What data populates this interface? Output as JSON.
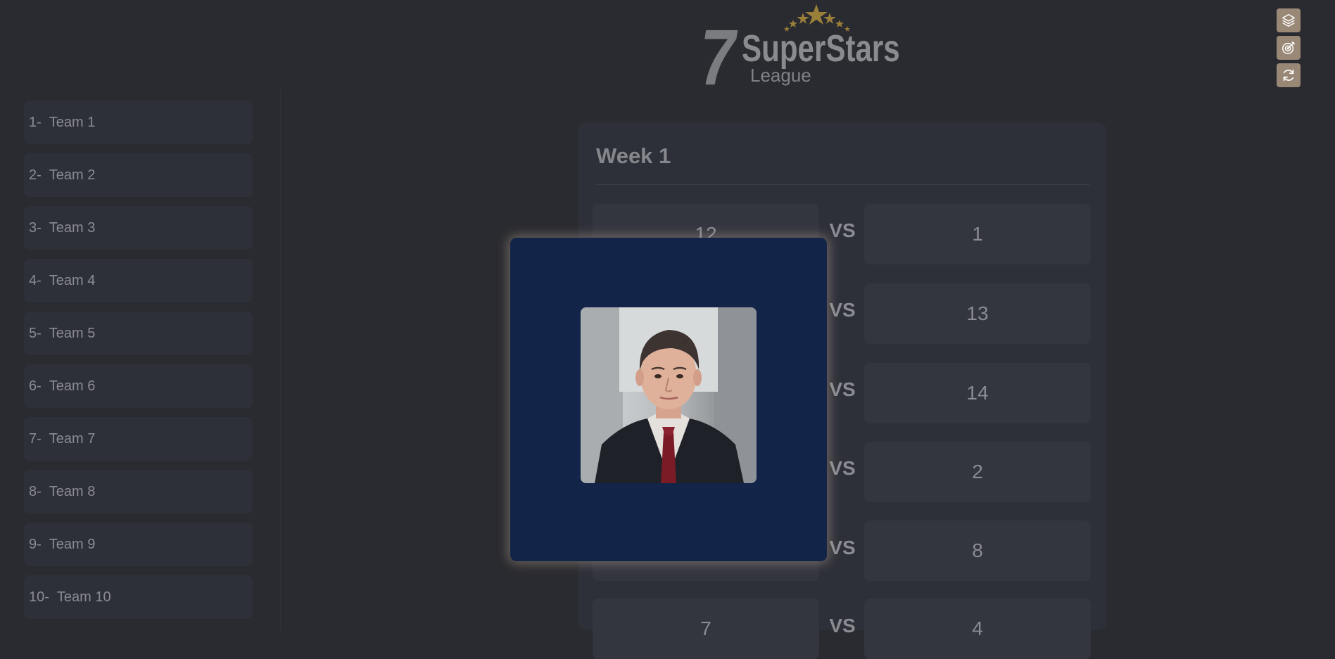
{
  "brand": {
    "number": "7",
    "name": "SuperStars",
    "subtitle": "League",
    "star_color": "#9a7f3a"
  },
  "toolbar": {
    "buttons": [
      {
        "icon": "layers-icon"
      },
      {
        "icon": "target-icon"
      },
      {
        "icon": "refresh-icon"
      }
    ],
    "accent": "#9a8877"
  },
  "sidebar": {
    "items": [
      {
        "num": "1-",
        "label": "Team 1"
      },
      {
        "num": "2-",
        "label": "Team 2"
      },
      {
        "num": "3-",
        "label": "Team 3"
      },
      {
        "num": "4-",
        "label": "Team 4"
      },
      {
        "num": "5-",
        "label": "Team 5"
      },
      {
        "num": "6-",
        "label": "Team 6"
      },
      {
        "num": "7-",
        "label": "Team 7"
      },
      {
        "num": "8-",
        "label": "Team 8"
      },
      {
        "num": "9-",
        "label": "Team 9"
      },
      {
        "num": "10-",
        "label": "Team 10"
      }
    ]
  },
  "week": {
    "title": "Week 1",
    "vs_label": "VS",
    "matches": [
      {
        "home": "12",
        "away": "1"
      },
      {
        "home": "",
        "away": "13"
      },
      {
        "home": "",
        "away": "14"
      },
      {
        "home": "",
        "away": "2"
      },
      {
        "home": "",
        "away": "8"
      },
      {
        "home": "7",
        "away": "4"
      }
    ]
  },
  "modal": {
    "background": "#122447",
    "image": "portrait-photo"
  }
}
